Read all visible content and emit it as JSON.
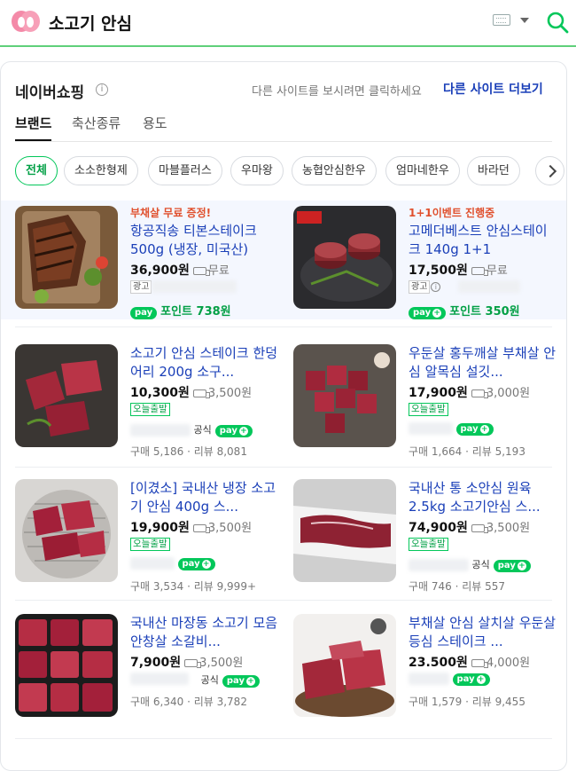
{
  "search": {
    "query": "소고기 안심"
  },
  "panel": {
    "title": "네이버쇼핑",
    "hint": "다른 사이트를 보시려면 클릭하세요",
    "more_link": "다른 사이트 더보기"
  },
  "tabs": [
    {
      "label": "브랜드"
    },
    {
      "label": "축산종류"
    },
    {
      "label": "용도"
    }
  ],
  "chips": [
    {
      "label": "전체"
    },
    {
      "label": "소소한형제"
    },
    {
      "label": "마블플러스"
    },
    {
      "label": "우마왕"
    },
    {
      "label": "농협안심한우"
    },
    {
      "label": "엄마네한우"
    },
    {
      "label": "바라던"
    }
  ],
  "products": [
    {
      "promo": "부채살 무료 증정!",
      "name": "항공직송 티본스테이크 500g (냉장, 미국산)",
      "price": "36,900원",
      "shipping": "무료",
      "ad": "광고",
      "point": "포인트 738원",
      "purchases": "",
      "reviews": ""
    },
    {
      "promo": "1+1이벤트 진행중",
      "name": "고메더베스트 안심스테이크 140g 1+1",
      "price": "17,500원",
      "shipping": "무료",
      "ad": "광고",
      "point": "포인트 350원",
      "purchases": "",
      "reviews": ""
    },
    {
      "promo": "",
      "name": "소고기 안심 스테이크 한덩어리 200g 소구...",
      "price": "10,300원",
      "shipping": "3,500원",
      "today": "오늘출발",
      "official": "공식",
      "purchases": "구매 5,186",
      "reviews": "리뷰 8,081"
    },
    {
      "promo": "",
      "name": "우둔살 홍두깨살 부채살 안심 알목심 설깃...",
      "price": "17,900원",
      "shipping": "3,000원",
      "today": "오늘출발",
      "purchases": "구매 1,664",
      "reviews": "리뷰 5,193"
    },
    {
      "promo": "",
      "name": "[이겼소] 국내산 냉장 소고기 안심 400g 스...",
      "price": "19,900원",
      "shipping": "3,500원",
      "today": "오늘출발",
      "purchases": "구매 3,534",
      "reviews": "리뷰 9,999+"
    },
    {
      "promo": "",
      "name": "국내산 통 소안심 원육 2.5kg 소고기안심 스...",
      "price": "74,900원",
      "shipping": "3,500원",
      "today": "오늘출발",
      "official": "공식",
      "purchases": "구매 746",
      "reviews": "리뷰 557"
    },
    {
      "promo": "",
      "name": "국내산 마장동 소고기 모음 안창살 소갈비...",
      "price": "7,900원",
      "shipping": "3,500원",
      "official": "공식",
      "purchases": "구매 6,340",
      "reviews": "리뷰 3,782"
    },
    {
      "promo": "",
      "name": "부채살 안심 살치살 우둔살 등심 스테이크 ...",
      "price": "23.500원",
      "shipping": "4,000원",
      "purchases": "구매 1,579",
      "reviews": "리뷰 9,455"
    }
  ],
  "labels": {
    "npay": "pay"
  },
  "colors": {
    "brand_green": "#03c75a",
    "link_blue": "#1a3fb8",
    "promo_orange": "#e0502d"
  },
  "icons": [
    "naver-logo-icon",
    "keyboard-icon",
    "search-icon",
    "info-icon",
    "chevron-right-icon",
    "truck-icon"
  ]
}
